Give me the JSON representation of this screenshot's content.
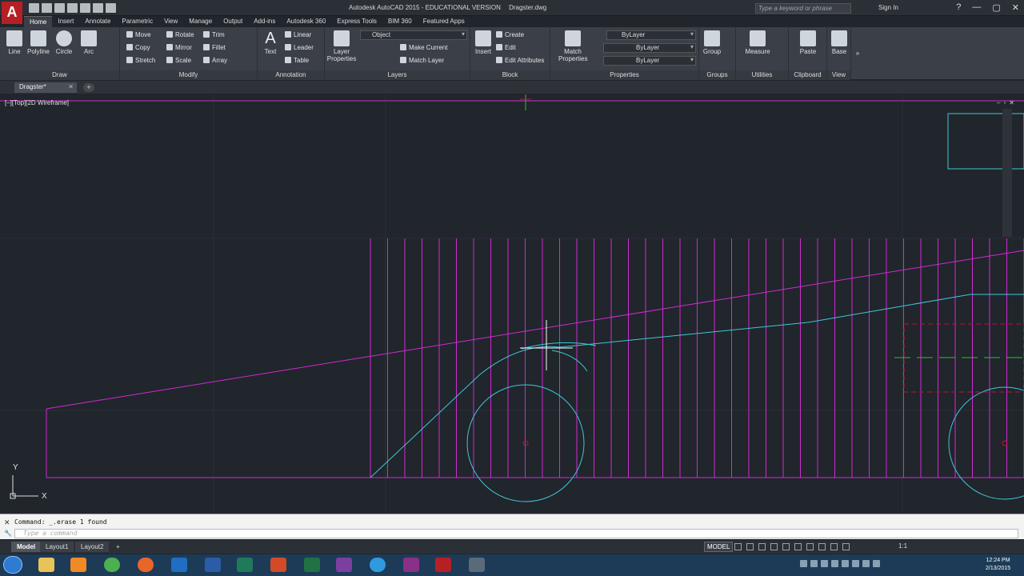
{
  "app": {
    "logo": "A",
    "title": "Autodesk AutoCAD 2015 - EDUCATIONAL VERSION",
    "file": "Dragster.dwg",
    "search_placeholder": "Type a keyword or phrase",
    "signin": "Sign In",
    "win_controls": [
      "?",
      "—",
      "▢",
      "✕"
    ]
  },
  "ribbon_tabs": [
    "Home",
    "Insert",
    "Annotate",
    "Parametric",
    "View",
    "Manage",
    "Output",
    "Add-ins",
    "Autodesk 360",
    "Express Tools",
    "BIM 360",
    "Featured Apps"
  ],
  "ribbon": {
    "draw": {
      "title": "Draw",
      "line": "Line",
      "polyline": "Polyline",
      "circle": "Circle",
      "arc": "Arc"
    },
    "modify": {
      "title": "Modify",
      "move": "Move",
      "rotate": "Rotate",
      "trim": "Trim",
      "copy": "Copy",
      "mirror": "Mirror",
      "fillet": "Fillet",
      "stretch": "Stretch",
      "scale": "Scale",
      "array": "Array"
    },
    "annotation": {
      "title": "Annotation",
      "text": "Text",
      "linear": "Linear",
      "leader": "Leader",
      "table": "Table"
    },
    "layers": {
      "title": "Layers",
      "layer_properties": "Layer\nProperties",
      "current_layer": "Object",
      "make_current": "Make Current",
      "match_layer": "Match Layer"
    },
    "block": {
      "title": "Block",
      "insert": "Insert",
      "create": "Create",
      "edit": "Edit",
      "edit_attributes": "Edit Attributes"
    },
    "properties": {
      "title": "Properties",
      "match": "Match\nProperties",
      "color": "ByLayer",
      "linetype": "ByLayer",
      "lineweight": "ByLayer"
    },
    "groups": {
      "title": "Groups",
      "group": "Group"
    },
    "utilities": {
      "title": "Utilities",
      "measure": "Measure"
    },
    "clipboard": {
      "title": "Clipboard",
      "paste": "Paste"
    },
    "view": {
      "title": "View",
      "base": "Base"
    },
    "collapse": "»"
  },
  "doc_tab": {
    "name": "Dragster*",
    "close": "✕",
    "new": "+"
  },
  "viewport": {
    "label": "[–][Top][2D Wireframe]",
    "controls": "–▫✕"
  },
  "ucs": {
    "y": "Y",
    "x": "X"
  },
  "command": {
    "history": "Command: _.erase 1 found",
    "placeholder": "Type a command",
    "close": "✕",
    "wrench": "🔧"
  },
  "layout_tabs": [
    "Model",
    "Layout1",
    "Layout2"
  ],
  "layout_add": "+",
  "status": {
    "model": "MODEL",
    "scale": "1:1"
  },
  "taskbar": {
    "time": "12:24 PM",
    "date": "2/13/2015"
  },
  "colors": {
    "magenta": "#d12bd1",
    "cyan": "#3ec9d6",
    "red": "#c8102e",
    "green": "#2fbf2f",
    "bg": "#21252c"
  }
}
